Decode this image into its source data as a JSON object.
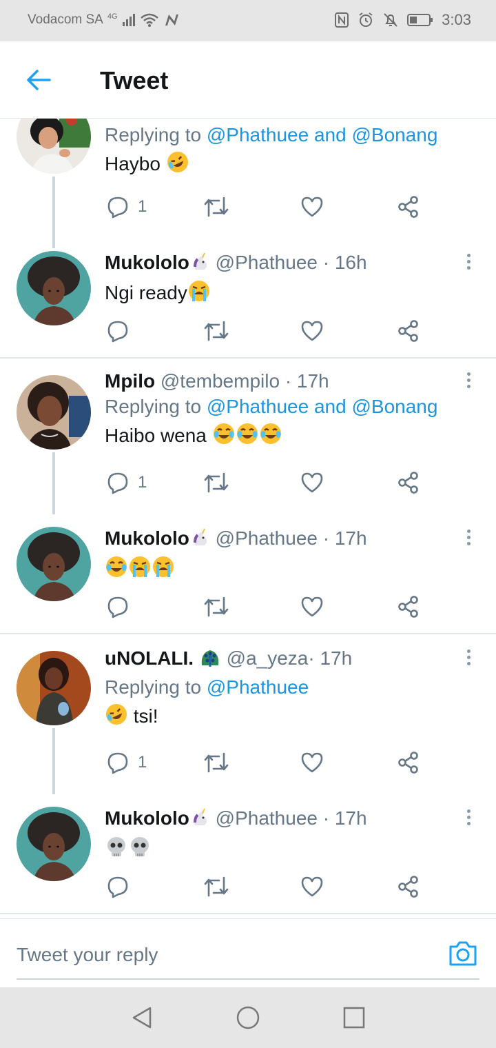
{
  "status_bar": {
    "carrier": "Vodacom SA",
    "network": "4G",
    "time": "3:03",
    "icons": [
      "signal-icon",
      "wifi-icon",
      "n-app-icon",
      "nfc-icon",
      "alarm-icon",
      "mute-icon",
      "battery-icon"
    ]
  },
  "header": {
    "back_icon": "back-arrow-icon",
    "title": "Tweet"
  },
  "tweets": [
    {
      "name": "",
      "handle": "",
      "time": "",
      "reply_prefix": "Replying to ",
      "reply_mentions": "@Phathuee and @Bonang",
      "text": "Haybo",
      "emojis": [
        "rofl"
      ],
      "reply_count": "1",
      "avatar": "woman-avatar-1"
    },
    {
      "name": "Mukololo",
      "name_emoji": "unicorn",
      "handle": "@Phathuee",
      "time": "· 16h",
      "text": "Ngi ready",
      "emojis": [
        "loudly-crying"
      ],
      "reply_count": "",
      "avatar": "afro-illustration-avatar"
    },
    {
      "name": "Mpilo",
      "handle": "@tembempilo",
      "time": "· 17h",
      "reply_prefix": "Replying to ",
      "reply_mentions": "@Phathuee and @Bonang",
      "text": "Haibo wena",
      "emojis": [
        "joy",
        "joy",
        "joy"
      ],
      "reply_count": "1",
      "avatar": "woman-avatar-2"
    },
    {
      "name": "Mukololo",
      "name_emoji": "unicorn",
      "handle": "@Phathuee",
      "time": "· 17h",
      "text": "",
      "emojis": [
        "joy",
        "loudly-crying",
        "loudly-crying"
      ],
      "reply_count": "",
      "avatar": "afro-illustration-avatar"
    },
    {
      "name": "uNOLALI.",
      "name_emoji": "peacock",
      "handle": "@a_yeza",
      "time": "· 17h",
      "reply_prefix": "Replying to ",
      "reply_mentions": "@Phathuee",
      "text": "tsi!",
      "emojis": [
        "rofl"
      ],
      "reply_count": "1",
      "avatar": "woman-avatar-3"
    },
    {
      "name": "Mukololo",
      "name_emoji": "unicorn",
      "handle": "@Phathuee",
      "time": "· 17h",
      "text": "",
      "emojis": [
        "skull",
        "skull"
      ],
      "reply_count": "",
      "avatar": "afro-illustration-avatar"
    }
  ],
  "action_icons": [
    "reply-icon",
    "retweet-icon",
    "like-icon",
    "share-icon"
  ],
  "reply_bar": {
    "placeholder": "Tweet your reply",
    "camera_icon": "camera-icon"
  },
  "nav_bar": {
    "icons": [
      "nav-back-icon",
      "nav-home-icon",
      "nav-recents-icon"
    ]
  },
  "colors": {
    "accent": "#1da1f2",
    "mention": "#1b95e0",
    "secondary_text": "#657786",
    "divider": "#e1e8ed",
    "thread_line": "#ccd6dd"
  }
}
